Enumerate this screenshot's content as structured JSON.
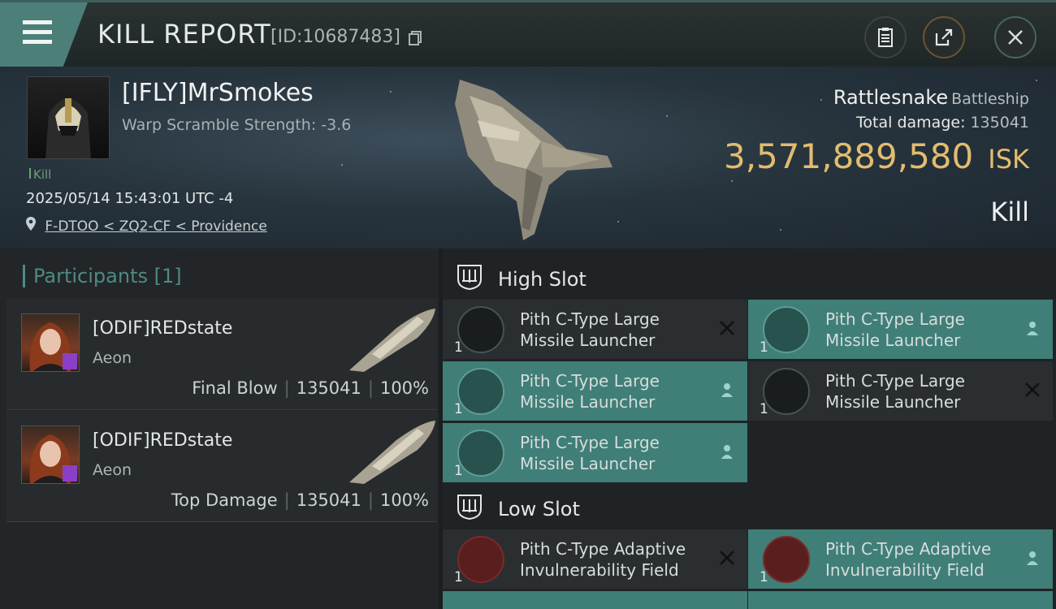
{
  "header": {
    "title": "KILL REPORT",
    "report_id": "[ID:10687483]",
    "buttons": [
      "clipboard-icon",
      "share-icon",
      "close-icon"
    ]
  },
  "victim": {
    "name": "[IFLY]MrSmokes",
    "warp_scramble": "Warp Scramble Strength: -3.6",
    "kill_tag": "Kill",
    "datetime": "2025/05/14 15:43:01 UTC -4",
    "location": "F-DTOO < ZQ2-CF < Providence",
    "ship_name": "Rattlesnake",
    "ship_class": "Battleship",
    "total_damage_label": "Total damage:",
    "total_damage": "135041",
    "isk_value": "3,571,889,580",
    "isk_unit": "ISK",
    "result": "Kill"
  },
  "participants": {
    "title": "Participants",
    "count": "[1]",
    "rows": [
      {
        "name": "[ODIF]REDstate",
        "ship": "Aeon",
        "role": "Final Blow",
        "damage": "135041",
        "percent": "100%"
      },
      {
        "name": "[ODIF]REDstate",
        "ship": "Aeon",
        "role": "Top Damage",
        "damage": "135041",
        "percent": "100%"
      }
    ],
    "separator": "|"
  },
  "fittings": {
    "high_slot_title": "High Slot",
    "low_slot_title": "Low Slot",
    "high_modules": [
      {
        "name_line1": "Pith C-Type Large",
        "name_line2": "Missile Launcher",
        "qty": "1",
        "status": "destroyed"
      },
      {
        "name_line1": "Pith C-Type Large",
        "name_line2": "Missile Launcher",
        "qty": "1",
        "status": "dropped"
      },
      {
        "name_line1": "Pith C-Type Large",
        "name_line2": "Missile Launcher",
        "qty": "1",
        "status": "dropped"
      },
      {
        "name_line1": "Pith C-Type Large",
        "name_line2": "Missile Launcher",
        "qty": "1",
        "status": "destroyed"
      },
      {
        "name_line1": "Pith C-Type Large",
        "name_line2": "Missile Launcher",
        "qty": "1",
        "status": "dropped"
      }
    ],
    "low_modules": [
      {
        "name_line1": "Pith C-Type Adaptive",
        "name_line2": "Invulnerability Field",
        "qty": "1",
        "status": "destroyed"
      },
      {
        "name_line1": "Pith C-Type Adaptive",
        "name_line2": "Invulnerability Field",
        "qty": "1",
        "status": "dropped"
      }
    ]
  },
  "colors": {
    "accent_teal": "#4d7f79",
    "dropped_bg": "#3f7f78",
    "isk_gold": "#e3bc6f",
    "kill_green": "#6e9f7c"
  }
}
